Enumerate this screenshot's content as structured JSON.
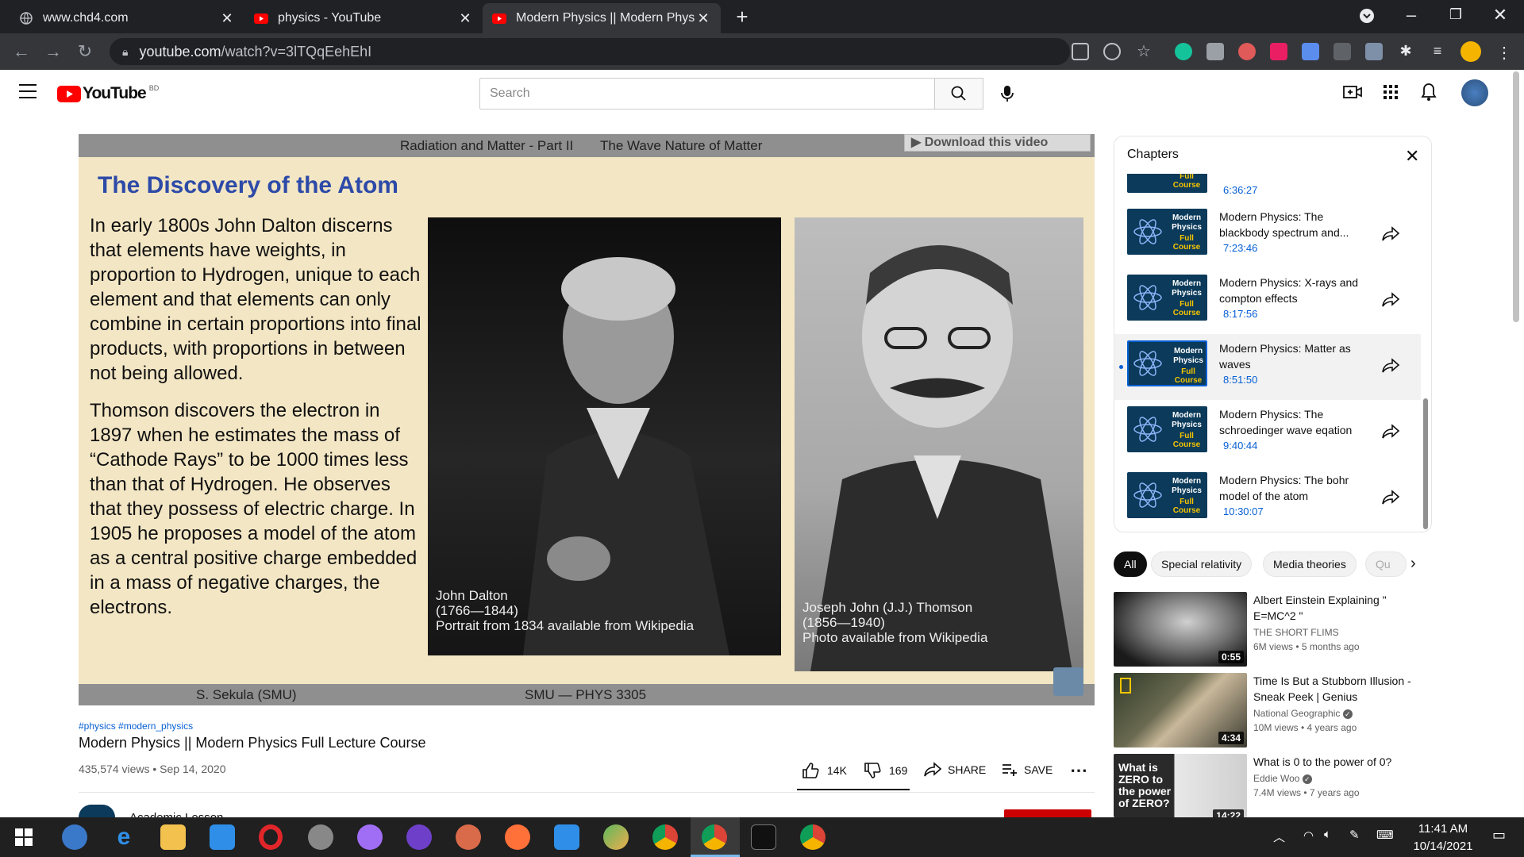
{
  "browser": {
    "tabs": [
      {
        "title": "www.chd4.com",
        "icon": "globe-icon"
      },
      {
        "title": "physics - YouTube",
        "icon": "youtube-icon"
      },
      {
        "title": "Modern Physics || Modern Physic",
        "icon": "youtube-icon"
      }
    ],
    "url_host": "youtube.com",
    "url_path": "/watch?v=3lTQqEehEhI"
  },
  "youtube": {
    "logo_text": "YouTube",
    "country_code": "BD",
    "search_placeholder": "Search"
  },
  "video": {
    "download_label": "▶ Download this video",
    "slide": {
      "header_left": "Radiation and Matter - Part II",
      "header_right": "The Wave Nature of Matter",
      "title": "The Discovery of the Atom",
      "para1": "In early 1800s John Dalton discerns that elements have weights, in proportion to Hydrogen, unique to each element and that elements can only combine in certain proportions into final products, with proportions in between not being allowed.",
      "para2": "Thomson discovers the electron in 1897 when he estimates the mass of “Cathode Rays” to be 1000 times less than that of Hydrogen. He observes that they possess of electric charge. In 1905 he proposes a model of the atom as a central positive charge embedded in a mass of negative charges, the electrons.",
      "caption_dalton": "John Dalton\n(1766—1844)\nPortrait from 1834 available from Wikipedia",
      "caption_thomson": "Joseph John (J.J.) Thomson\n(1856—1940)\nPhoto available from Wikipedia",
      "footer_left": "S. Sekula  (SMU)",
      "footer_right": "SMU — PHYS 3305"
    },
    "hashtags": "#physics #modern_physics",
    "title": "Modern Physics || Modern Physics Full Lecture Course",
    "views_date": "435,574 views • Sep 14, 2020",
    "likes": "14K",
    "dislikes": "169",
    "share_label": "SHARE",
    "save_label": "SAVE",
    "channel_partial": "Academic Lesson"
  },
  "chapters": {
    "heading": "Chapters",
    "thumb_line1": "Modern Physics",
    "thumb_line2": "Full Course",
    "top_partial_time": "6:36:27",
    "items": [
      {
        "title": "Modern Physics: The blackbody spectrum and...",
        "time": "7:23:46"
      },
      {
        "title": "Modern Physics: X-rays and compton effects",
        "time": "8:17:56"
      },
      {
        "title": "Modern Physics: Matter as waves",
        "time": "8:51:50"
      },
      {
        "title": "Modern Physics: The schroedinger wave eqation",
        "time": "9:40:44"
      },
      {
        "title": "Modern Physics: The bohr model of the atom",
        "time": "10:30:07"
      }
    ]
  },
  "chips": [
    "All",
    "Special relativity",
    "Media theories",
    "Qu"
  ],
  "recommendations": [
    {
      "title": "Albert Einstein Explaining \" E=MC^2 \"",
      "channel": "THE SHORT FLIMS",
      "stats": "6M views • 5 months ago",
      "duration": "0:55"
    },
    {
      "title": "Time Is But a Stubborn Illusion - Sneak Peek | Genius",
      "channel": "National Geographic",
      "stats": "10M views • 4 years ago",
      "duration": "4:34"
    },
    {
      "title": "What is 0 to the power of 0?",
      "channel": "Eddie Woo",
      "stats": "7.4M views • 7 years ago",
      "duration": "14:22",
      "thumb_text": "What is ZERO to the power of ZERO?"
    }
  ],
  "taskbar": {
    "time": "11:41 AM",
    "date": "10/14/2021"
  },
  "colors": {
    "accent_red": "#ff0000",
    "link_blue": "#065fd4",
    "slide_bg": "#f3e6c4",
    "slide_title": "#2d4aa8"
  }
}
